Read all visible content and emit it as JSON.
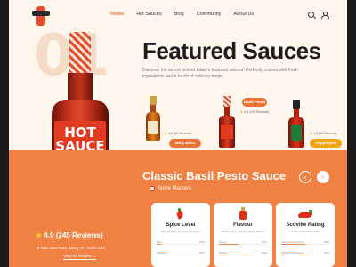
{
  "nav": {
    "items": [
      {
        "label": "Home",
        "active": true
      },
      {
        "label": "Hot Sauces",
        "active": false
      },
      {
        "label": "Blog",
        "active": false
      },
      {
        "label": "Community",
        "active": false
      },
      {
        "label": "About Us",
        "active": false
      }
    ],
    "icons": [
      "search-icon",
      "user-icon"
    ]
  },
  "hero": {
    "number": "01",
    "bottle_label": "HOT\nSAUCE",
    "bottle_oz": "5 FL. OZ. (148ML)",
    "title": "Featured Sauces",
    "description": "Discover the secret behind today's featured sauces! Perfectly crafted with fresh ingredients and a touch of culinary magic.",
    "rating": "4.9 (245 Reviews)",
    "address": "3024 Joes Road, Albany, NY 12201 USA",
    "view_all": "View All Review"
  },
  "products": [
    {
      "name": "BBQ Bliss",
      "reviews": "4.9 (52 Reviews)",
      "pill_color": "#e8743a"
    },
    {
      "name": "Basil Pesto",
      "reviews": "4.8 (120 Reviews)",
      "pill_color": "#e8743a"
    },
    {
      "name": "Pepperjam",
      "reviews": "4.8 (50 Reviews)",
      "pill_color": "#f2a514"
    }
  ],
  "detail": {
    "title": "Classic Basil Pesto Sauce",
    "brand": "Spice Masters",
    "cards": [
      {
        "title": "Spice Level",
        "subtitle": "Mild, Medium, Hot, Fiery, Extreme",
        "icon": "chili-icon",
        "rows": [
          {
            "label": "Mild",
            "value": "10%",
            "fill": 0.1
          },
          {
            "label": "Medium",
            "value": "30%",
            "fill": 0.3
          }
        ]
      },
      {
        "title": "Flavour",
        "subtitle": "Sweet, Spicy, Smoky, Tangy, Savory",
        "icon": "bottle-icon",
        "rows": [
          {
            "label": "Sweet",
            "value": "40%",
            "fill": 0.4
          },
          {
            "label": "Smoky",
            "value": "70%",
            "fill": 0.7
          }
        ]
      },
      {
        "title": "Scoville Rating",
        "subtitle": "0-1000, 1000-5000, 5000+",
        "icon": "pepper-icon",
        "rows": [
          {
            "label": "Scoville Heat Units",
            "value": "2500",
            "fill": 0.5
          },
          {
            "label": "Pepper Ingredients",
            "value": "Chili",
            "fill": 0.6
          }
        ]
      }
    ]
  }
}
